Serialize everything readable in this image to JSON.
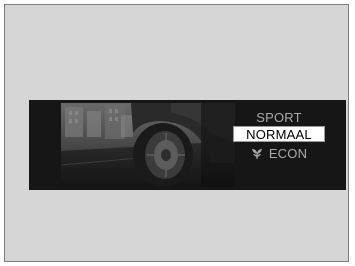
{
  "drive_mode_display": {
    "modes": [
      {
        "label": "SPORT",
        "selected": false
      },
      {
        "label": "NORMAAL",
        "selected": true
      },
      {
        "label": "ECON",
        "selected": false,
        "icon": "leaf-icon"
      }
    ]
  }
}
